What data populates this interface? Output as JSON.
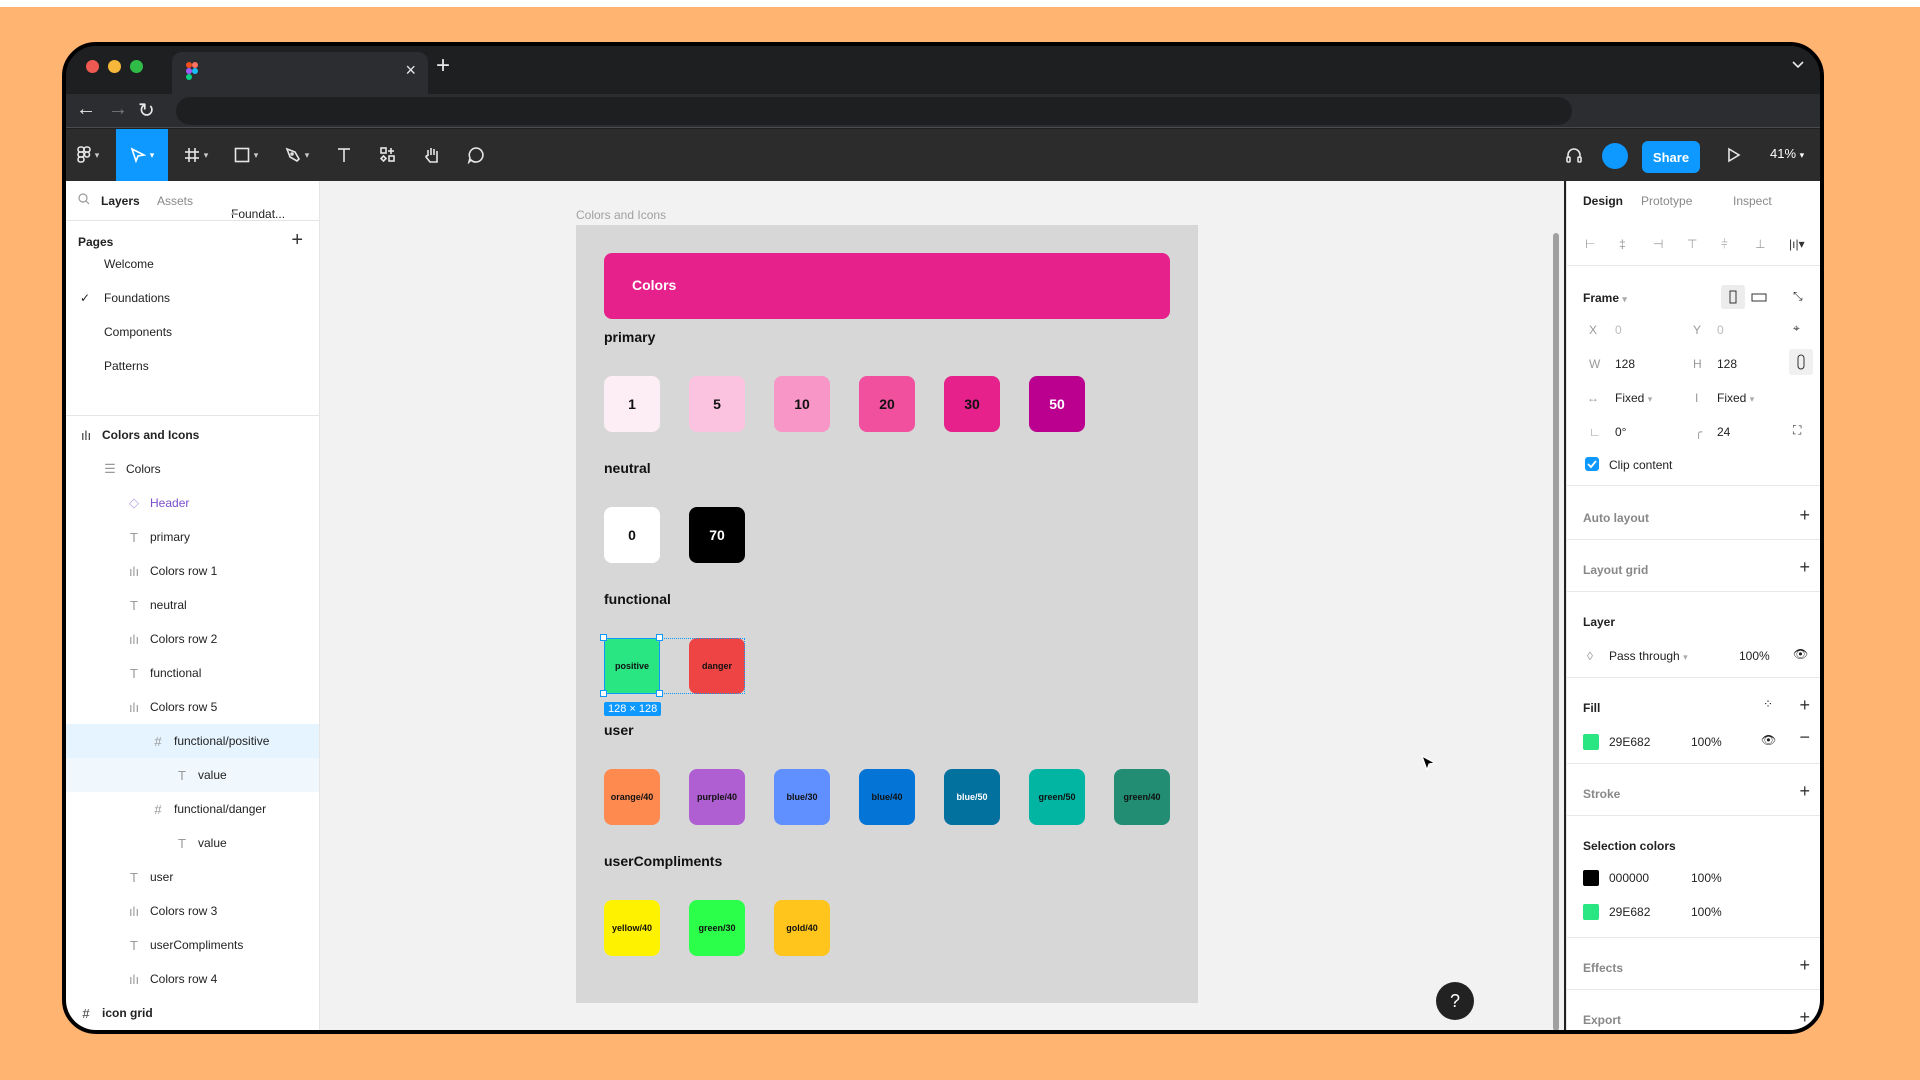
{
  "browser": {
    "tab_close": "×",
    "new_tab": "+",
    "tabs_menu": "⌄",
    "back": "←",
    "forward": "→",
    "reload": "↻"
  },
  "toolbar": {
    "tools": [
      "main-menu",
      "move",
      "frame",
      "shape",
      "pen",
      "text",
      "resources",
      "hand",
      "comment"
    ],
    "share_label": "Share",
    "zoom": "41%",
    "accent": "#0d99ff"
  },
  "left_panel": {
    "tabs": {
      "layers": "Layers",
      "assets": "Assets",
      "page_selector": "Foundat..."
    },
    "pages_title": "Pages",
    "pages": [
      {
        "label": "Welcome",
        "current": false
      },
      {
        "label": "Foundations",
        "current": true
      },
      {
        "label": "Components",
        "current": false
      },
      {
        "label": "Patterns",
        "current": false
      }
    ],
    "layers": [
      {
        "label": "Colors and Icons",
        "type": "auto-layout",
        "depth": 0,
        "bold": true
      },
      {
        "label": "Colors",
        "type": "vertical-layout",
        "depth": 1
      },
      {
        "label": "Header",
        "type": "instance",
        "depth": 2,
        "color": "#7b4fc9"
      },
      {
        "label": "primary",
        "type": "text",
        "depth": 2
      },
      {
        "label": "Colors row 1",
        "type": "auto-layout",
        "depth": 2
      },
      {
        "label": "neutral",
        "type": "text",
        "depth": 2
      },
      {
        "label": "Colors row 2",
        "type": "auto-layout",
        "depth": 2
      },
      {
        "label": "functional",
        "type": "text",
        "depth": 2
      },
      {
        "label": "Colors row 5",
        "type": "auto-layout",
        "depth": 2
      },
      {
        "label": "functional/positive",
        "type": "frame",
        "depth": 3,
        "selected": true
      },
      {
        "label": "value",
        "type": "text",
        "depth": 4,
        "selected_child": true
      },
      {
        "label": "functional/danger",
        "type": "frame",
        "depth": 3
      },
      {
        "label": "value",
        "type": "text",
        "depth": 4
      },
      {
        "label": "user",
        "type": "text",
        "depth": 2
      },
      {
        "label": "Colors row 3",
        "type": "auto-layout",
        "depth": 2
      },
      {
        "label": "userCompliments",
        "type": "text",
        "depth": 2
      },
      {
        "label": "Colors row 4",
        "type": "auto-layout",
        "depth": 2
      },
      {
        "label": "icon grid",
        "type": "frame",
        "depth": 0,
        "bold": true
      }
    ]
  },
  "canvas": {
    "frame_label": "Colors and Icons",
    "header_title": "Colors",
    "selection_size": "128 × 128",
    "sections": [
      {
        "title": "primary",
        "swatches": [
          {
            "label": "1",
            "bg": "#fdeef6",
            "fg": "#111111"
          },
          {
            "label": "5",
            "bg": "#fbc3e0",
            "fg": "#111111"
          },
          {
            "label": "10",
            "bg": "#f996c8",
            "fg": "#111111"
          },
          {
            "label": "20",
            "bg": "#f0509e",
            "fg": "#111111"
          },
          {
            "label": "30",
            "bg": "#e6218c",
            "fg": "#111111"
          },
          {
            "label": "50",
            "bg": "#bb0090",
            "fg": "#ffffff"
          }
        ]
      },
      {
        "title": "neutral",
        "swatches": [
          {
            "label": "0",
            "bg": "#ffffff",
            "fg": "#111111"
          },
          {
            "label": "70",
            "bg": "#000000",
            "fg": "#ffffff"
          }
        ]
      },
      {
        "title": "functional",
        "swatches": [
          {
            "label": "positive",
            "bg": "#29e682",
            "fg": "#111111",
            "small": true
          },
          {
            "label": "danger",
            "bg": "#ef4444",
            "fg": "#111111",
            "small": true
          }
        ]
      },
      {
        "title": "user",
        "swatches": [
          {
            "label": "orange/40",
            "bg": "#ff8a50",
            "fg": "#111111",
            "small": true
          },
          {
            "label": "purple/40",
            "bg": "#b05fd3",
            "fg": "#111111",
            "small": true
          },
          {
            "label": "blue/30",
            "bg": "#6090ff",
            "fg": "#111111",
            "small": true
          },
          {
            "label": "blue/40",
            "bg": "#0474d6",
            "fg": "#111111",
            "small": true
          },
          {
            "label": "blue/50",
            "bg": "#02719d",
            "fg": "#ffffff",
            "small": true
          },
          {
            "label": "green/50",
            "bg": "#02b5a3",
            "fg": "#111111",
            "small": true
          },
          {
            "label": "green/40",
            "bg": "#228d73",
            "fg": "#111111",
            "small": true
          }
        ]
      },
      {
        "title": "userCompliments",
        "swatches": [
          {
            "label": "yellow/40",
            "bg": "#fff200",
            "fg": "#111111",
            "small": true
          },
          {
            "label": "green/30",
            "bg": "#2cff4a",
            "fg": "#111111",
            "small": true
          },
          {
            "label": "gold/40",
            "bg": "#ffc51c",
            "fg": "#111111",
            "small": true
          }
        ]
      }
    ]
  },
  "right_panel": {
    "tabs": {
      "design": "Design",
      "prototype": "Prototype",
      "inspect": "Inspect"
    },
    "frame": {
      "title": "Frame",
      "x_label": "X",
      "x": "0",
      "y_label": "Y",
      "y": "0",
      "w_label": "W",
      "w": "128",
      "h_label": "H",
      "h": "128",
      "h_sizing": "Fixed",
      "v_sizing": "Fixed",
      "rotation": "0°",
      "radius": "24",
      "clip_content_label": "Clip content",
      "clip_content": true
    },
    "auto_layout_title": "Auto layout",
    "layout_grid_title": "Layout grid",
    "layer": {
      "title": "Layer",
      "blend": "Pass through",
      "opacity": "100%"
    },
    "fill": {
      "title": "Fill",
      "hex": "29E682",
      "color": "#29e682",
      "opacity": "100%"
    },
    "stroke_title": "Stroke",
    "selection_colors": {
      "title": "Selection colors",
      "items": [
        {
          "hex": "000000",
          "color": "#000000",
          "opacity": "100%"
        },
        {
          "hex": "29E682",
          "color": "#29e682",
          "opacity": "100%"
        }
      ]
    },
    "effects_title": "Effects",
    "export_title": "Export",
    "help": "?"
  }
}
